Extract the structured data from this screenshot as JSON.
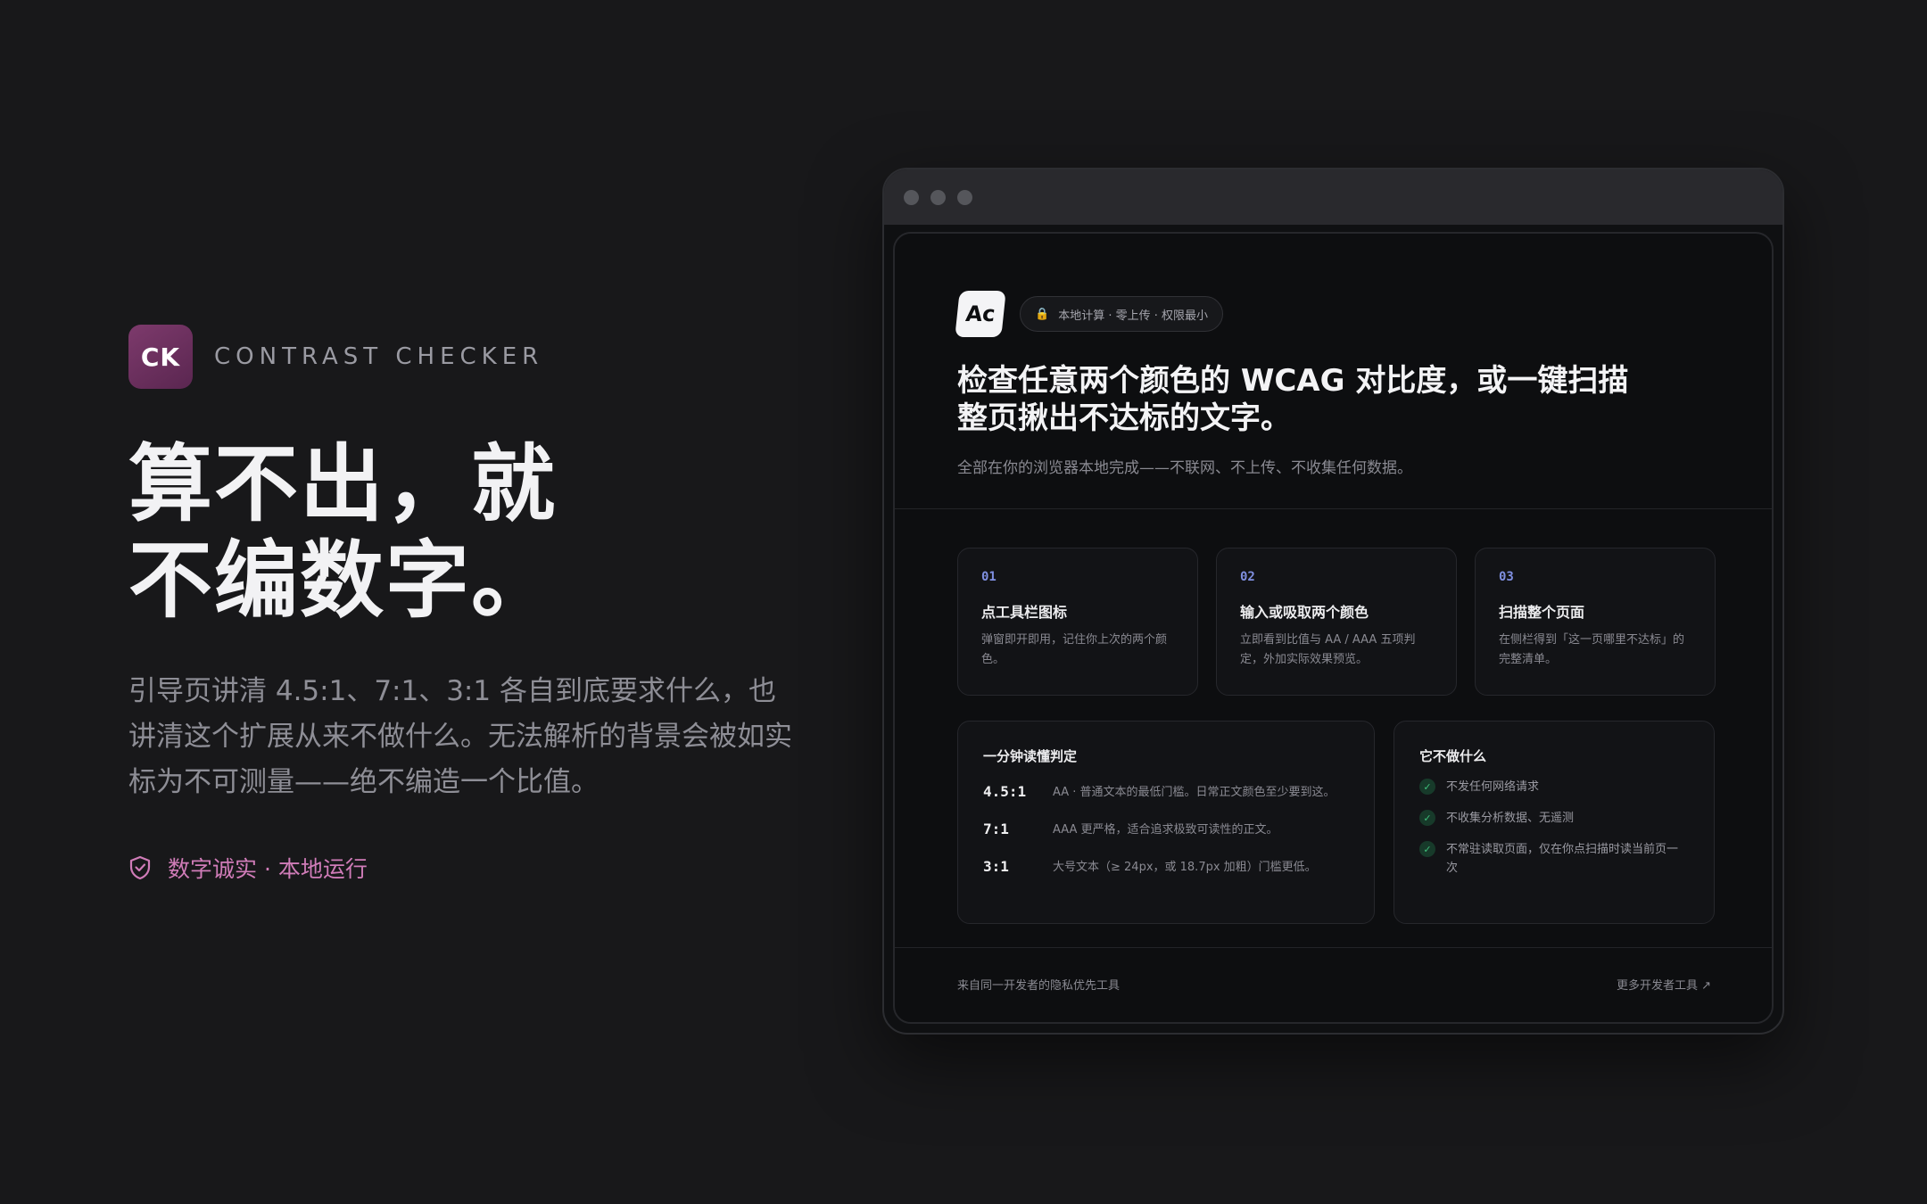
{
  "brand": {
    "logo": "CK",
    "name": "CONTRAST CHECKER"
  },
  "hero": {
    "headline_line1": "算不出，就",
    "headline_line2": "不编数字。",
    "lede": "引导页讲清 4.5:1、7:1、3:1 各自到底要求什么，也讲清这个扩展从来不做什么。无法解析的背景会被如实标为不可测量——绝不编造一个比值。",
    "badge_icon": "shield-check-icon",
    "badge": "数字诚实 · 本地运行"
  },
  "browser": {
    "logo_text": "Ac",
    "pill": "本地计算 · 零上传 · 权限最小",
    "title": "检查任意两个颜色的 WCAG 对比度，或一键扫描整页揪出不达标的文字。",
    "subtitle": "全部在你的浏览器本地完成——不联网、不上传、不收集任何数据。",
    "steps": [
      {
        "num": "01",
        "title": "点工具栏图标",
        "desc": "弹窗即开即用，记住你上次的两个颜色。"
      },
      {
        "num": "02",
        "title": "输入或吸取两个颜色",
        "desc": "立即看到比值与 AA / AAA 五项判定，外加实际效果预览。"
      },
      {
        "num": "03",
        "title": "扫描整个页面",
        "desc": "在侧栏得到「这一页哪里不达标」的完整清单。"
      }
    ],
    "judge": {
      "title": "一分钟读懂判定",
      "rules": [
        {
          "ratio": "4.5:1",
          "text": "AA · 普通文本的最低门槛。日常正文颜色至少要到这。"
        },
        {
          "ratio": "7:1",
          "text": "AAA 更严格，适合追求极致可读性的正文。"
        },
        {
          "ratio": "3:1",
          "text": "大号文本（≥ 24px，或 18.7px 加粗）门槛更低。"
        }
      ]
    },
    "nots": {
      "title": "它不做什么",
      "items": [
        "不发任何网络请求",
        "不收集分析数据、无遥测",
        "不常驻读取页面，仅在你点扫描时读当前页一次"
      ]
    },
    "footer": {
      "left": "来自同一开发者的隐私优先工具",
      "right": "更多开发者工具 ↗"
    }
  }
}
